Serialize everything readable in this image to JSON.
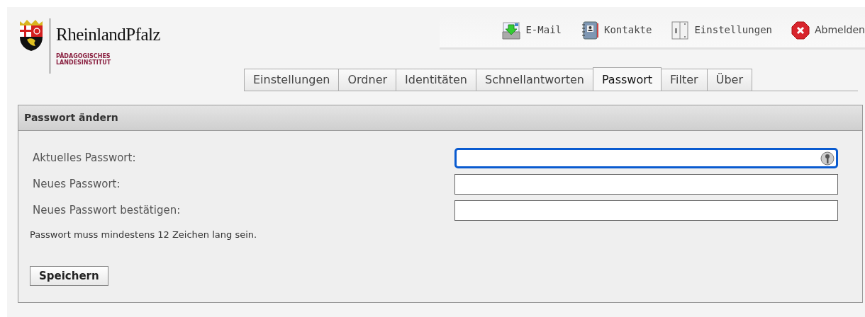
{
  "logo": {
    "wordmark": "RheinlandPfalz",
    "subtitle": [
      "PÄDAGOGISCHES",
      "LANDESINSTITUT"
    ]
  },
  "toolbar": [
    {
      "label": "E-Mail",
      "kind": "mail"
    },
    {
      "label": "Kontakte",
      "kind": "contacts"
    },
    {
      "label": "Einstellungen",
      "kind": "settings"
    },
    {
      "label": "Abmelden",
      "kind": "logout"
    }
  ],
  "tabs": [
    {
      "label": "Einstellungen",
      "selected": false
    },
    {
      "label": "Ordner",
      "selected": false
    },
    {
      "label": "Identitäten",
      "selected": false
    },
    {
      "label": "Schnellantworten",
      "selected": false
    },
    {
      "label": "Passwort",
      "selected": true
    },
    {
      "label": "Filter",
      "selected": false
    },
    {
      "label": "Über",
      "selected": false
    }
  ],
  "panel": {
    "title": "Passwort ändern",
    "fields": [
      {
        "label": "Aktuelles Passwort:",
        "focused": true
      },
      {
        "label": "Neues Passwort:",
        "focused": false
      },
      {
        "label": "Neues Passwort bestätigen:",
        "focused": false
      }
    ],
    "hint": "Passwort muss mindestens 12 Zeichen lang sein.",
    "button": "Speichern"
  }
}
